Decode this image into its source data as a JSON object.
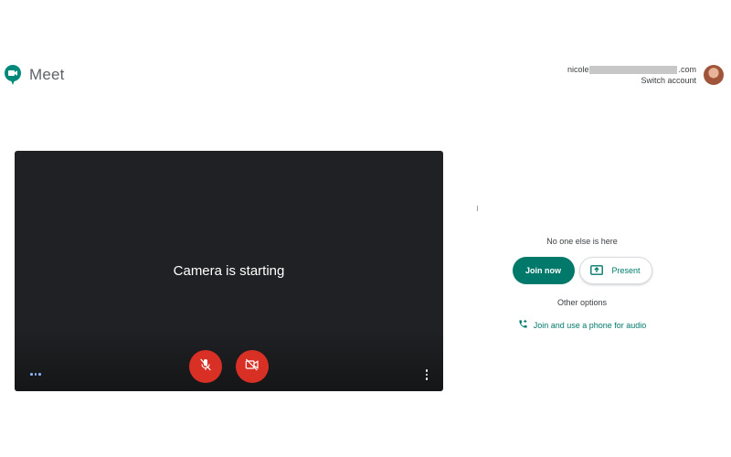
{
  "header": {
    "app_name": "Meet",
    "account": {
      "email_prefix": "nicole",
      "email_suffix": ".com",
      "switch_label": "Switch account"
    }
  },
  "preview": {
    "status": "Camera is starting",
    "mic_state": "muted",
    "camera_state": "off"
  },
  "panel": {
    "status": "No one else is here",
    "join_label": "Join now",
    "present_label": "Present",
    "other_options_label": "Other options",
    "phone_audio_label": "Join and use a phone for audio"
  },
  "colors": {
    "accent": "#00796b",
    "danger": "#d93025",
    "preview_bg": "#202124"
  },
  "icons": {
    "logo": "meet-logo-icon",
    "mic": "mic-off-icon",
    "camera": "videocam-off-icon",
    "present": "present-screen-icon",
    "phone": "phone-add-icon",
    "more_left": "more-horizontal-icon",
    "more_right": "more-vertical-icon"
  }
}
